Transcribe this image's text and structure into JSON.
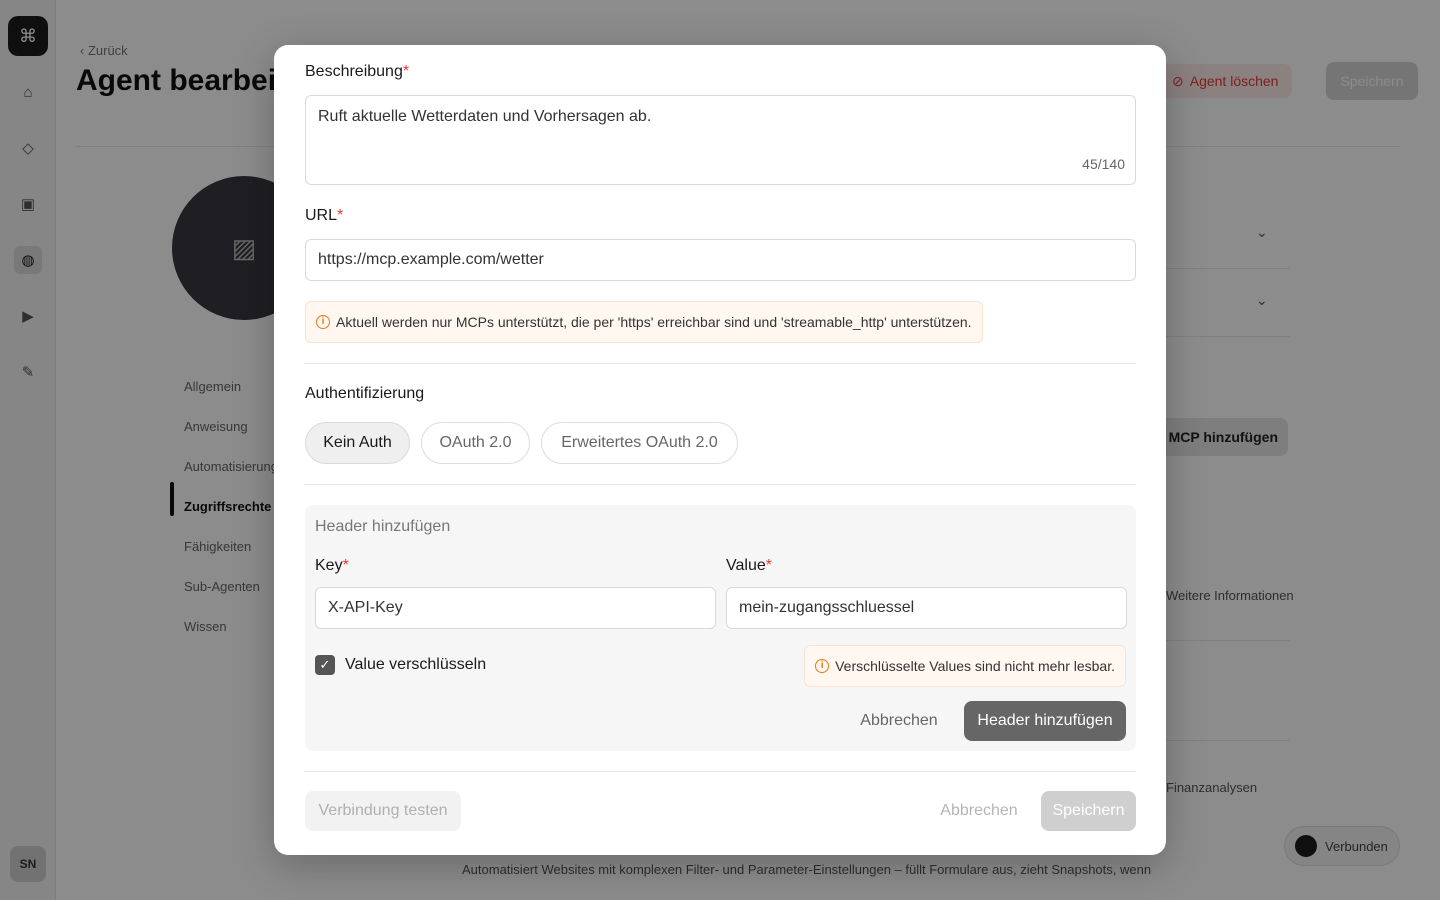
{
  "background": {
    "rail": {
      "logo_glyph": "⌘",
      "items": [
        "⌂",
        "◇",
        "▣",
        "◍",
        "▶",
        "✎"
      ],
      "user_initials": "SN"
    },
    "back_link": "‹ Zurück",
    "page_title": "Agent bearbeiten",
    "delete_button": "Agent löschen",
    "save_button": "Speichern",
    "nav": [
      "Allgemein",
      "Anweisung",
      "Automatisierung",
      "Zugriffsrechte",
      "Fähigkeiten",
      "Sub-Agenten",
      "Wissen"
    ],
    "add_mcp_button": "MCP hinzufügen",
    "more_info": "Weitere Informationen",
    "finance_text": "Finanzanalysen",
    "status_label": "Verbunden",
    "desc_text": "Automatisiert Websites mit komplexen Filter- und Parameter-Einstellungen – füllt Formulare aus, zieht Snapshots, wenn"
  },
  "modal": {
    "description": {
      "label": "Beschreibung",
      "required": "*",
      "value": "Ruft aktuelle Wetterdaten und Vorhersagen ab.",
      "counter": "45/140"
    },
    "url": {
      "label": "URL",
      "required": "*",
      "value": "https://mcp.example.com/wetter",
      "note": "Aktuell werden nur MCPs unterstützt, die per 'https' erreichbar sind und 'streamable_http' unterstützen."
    },
    "auth": {
      "label": "Authentifizierung",
      "options": [
        "Kein Auth",
        "OAuth 2.0",
        "Erweitertes OAuth 2.0"
      ],
      "selected": "Kein Auth"
    },
    "header_form": {
      "title": "Header hinzufügen",
      "key_label": "Key",
      "key_value": "X-API-Key",
      "value_label": "Value",
      "value_value": "mein-zugangsschluessel",
      "required": "*",
      "encrypt_label": "Value verschlüsseln",
      "encrypt_checked": true,
      "encrypt_note": "Verschlüsselte Values sind nicht mehr lesbar.",
      "cancel": "Abbrechen",
      "submit": "Header hinzufügen"
    },
    "footer": {
      "test_connection": "Verbindung testen",
      "cancel": "Abbrechen",
      "save": "Speichern"
    }
  },
  "colors": {
    "required": "#e53935",
    "info": "#e07a1f",
    "primary_button": "#666666"
  }
}
